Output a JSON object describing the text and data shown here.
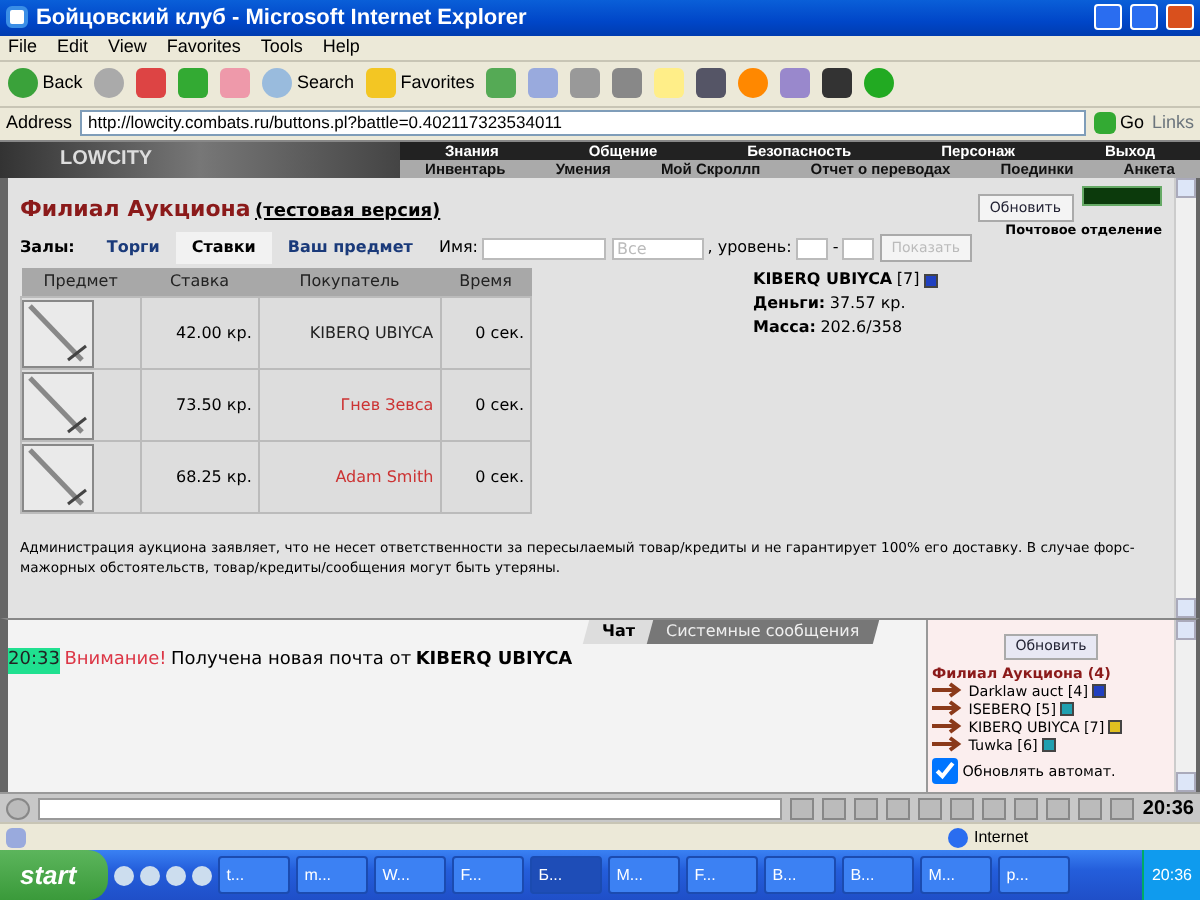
{
  "window": {
    "title": "Бойцовский клуб - Microsoft Internet Explorer"
  },
  "menu": [
    "File",
    "Edit",
    "View",
    "Favorites",
    "Tools",
    "Help"
  ],
  "toolbar": {
    "back": "Back",
    "search": "Search",
    "favorites": "Favorites"
  },
  "address": {
    "label": "Address",
    "url": "http://lowcity.combats.ru/buttons.pl?battle=0.402117323534011",
    "go": "Go",
    "links": "Links"
  },
  "game_header": {
    "logo": "LOWCITY",
    "top_menu": [
      "Знания",
      "Общение",
      "Безопасность",
      "Персонаж",
      "Выход"
    ],
    "sub_menu": [
      "Инвентарь",
      "Умения",
      "Мой Скроллп",
      "Отчет о переводах",
      "Поединки",
      "Анкета"
    ]
  },
  "auction": {
    "title": "Филиал Аукциона",
    "subtitle": "(тестовая версия)",
    "halls_label": "Залы:",
    "tabs": [
      {
        "label": "Торги",
        "selected": false
      },
      {
        "label": "Ставки",
        "selected": true
      },
      {
        "label": "Ваш предмет",
        "selected": false
      }
    ],
    "filter": {
      "name_label": "Имя:",
      "category": "Все",
      "level_label": ", уровень:",
      "dash": "-",
      "show_button": "Показать"
    },
    "refresh_button": "Обновить",
    "post_link": "Почтовое отделение",
    "columns": [
      "Предмет",
      "Ставка",
      "Покупатель",
      "Время"
    ],
    "rows": [
      {
        "bid": "42.00 кр.",
        "buyer": "KIBERQ UBIYCA",
        "color": "#222222",
        "time": "0 сек."
      },
      {
        "bid": "73.50 кр.",
        "buyer": "Гнев Зевса",
        "color": "#cc3333",
        "time": "0 сек."
      },
      {
        "bid": "68.25 кр.",
        "buyer": "Adam Smith",
        "color": "#cc3333",
        "time": "0 сек."
      }
    ],
    "player": {
      "name": "KIBERQ UBIYCA",
      "level": "[7]",
      "color": "#2040c0",
      "money_label": "Деньги:",
      "money": "37.57 кр.",
      "mass_label": "Масса:",
      "mass": "202.6/358"
    },
    "disclaimer": "Администрация аукциона заявляет, что не несет ответственности за пересылаемый товар/кредиты и не гарантирует 100% его доставку. В случае форс-мажорных обстоятельств, товар/кредиты/сообщения могут быть утеряны."
  },
  "chat": {
    "tabs": [
      {
        "label": "Чат",
        "selected": true
      },
      {
        "label": "Системные сообщения",
        "selected": false
      }
    ],
    "messages": [
      {
        "time": "20:33",
        "alert": "Внимание!",
        "text": "Получена новая почта от",
        "sender": "KIBERQ UBIYCA"
      }
    ]
  },
  "room": {
    "refresh_button": "Обновить",
    "title": "Филиал Аукциона (4)",
    "users": [
      {
        "name": "Darklaw auct",
        "level": "[4]",
        "color": "#2040c0"
      },
      {
        "name": "ISEBERQ",
        "level": "[5]",
        "color": "#20a0b0"
      },
      {
        "name": "KIBERQ UBIYCA",
        "level": "[7]",
        "color": "#e0c020"
      },
      {
        "name": "Tuwka",
        "level": "[6]",
        "color": "#20a0b0"
      }
    ],
    "auto_refresh": {
      "label": "Обновлять автомат.",
      "checked": true
    }
  },
  "game_clock": "20:36",
  "status_bar": {
    "zone": "Internet"
  },
  "taskbar": {
    "start": "start",
    "tasks": [
      {
        "label": "t...",
        "selected": false
      },
      {
        "label": "m...",
        "selected": false
      },
      {
        "label": "W...",
        "selected": false
      },
      {
        "label": "F...",
        "selected": false
      },
      {
        "label": "Б...",
        "selected": true
      },
      {
        "label": "M...",
        "selected": false
      },
      {
        "label": "F...",
        "selected": false
      },
      {
        "label": "B...",
        "selected": false
      },
      {
        "label": "B...",
        "selected": false
      },
      {
        "label": "M...",
        "selected": false
      },
      {
        "label": "p...",
        "selected": false
      }
    ],
    "clock": "20:36"
  }
}
